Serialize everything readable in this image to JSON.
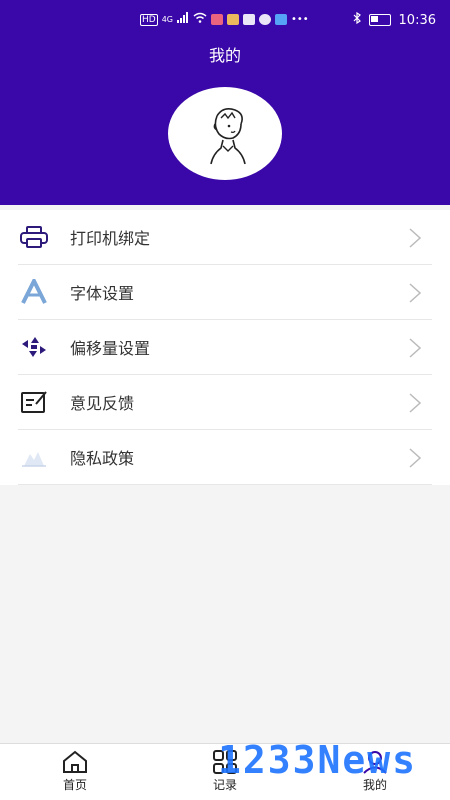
{
  "status_bar": {
    "time": "10:36"
  },
  "header": {
    "title": "我的"
  },
  "menu": {
    "items": [
      {
        "label": "打印机绑定",
        "icon": "printer-icon"
      },
      {
        "label": "字体设置",
        "icon": "font-icon"
      },
      {
        "label": "偏移量设置",
        "icon": "offset-icon"
      },
      {
        "label": "意见反馈",
        "icon": "feedback-icon"
      },
      {
        "label": "隐私政策",
        "icon": "privacy-icon"
      }
    ]
  },
  "tabs": [
    {
      "label": "首页",
      "icon": "home-icon"
    },
    {
      "label": "记录",
      "icon": "grid-icon"
    },
    {
      "label": "我的",
      "icon": "profile-icon"
    }
  ],
  "watermark": "1233News",
  "colors": {
    "header_bg": "#3a07a8",
    "accent": "#3a07a8"
  }
}
